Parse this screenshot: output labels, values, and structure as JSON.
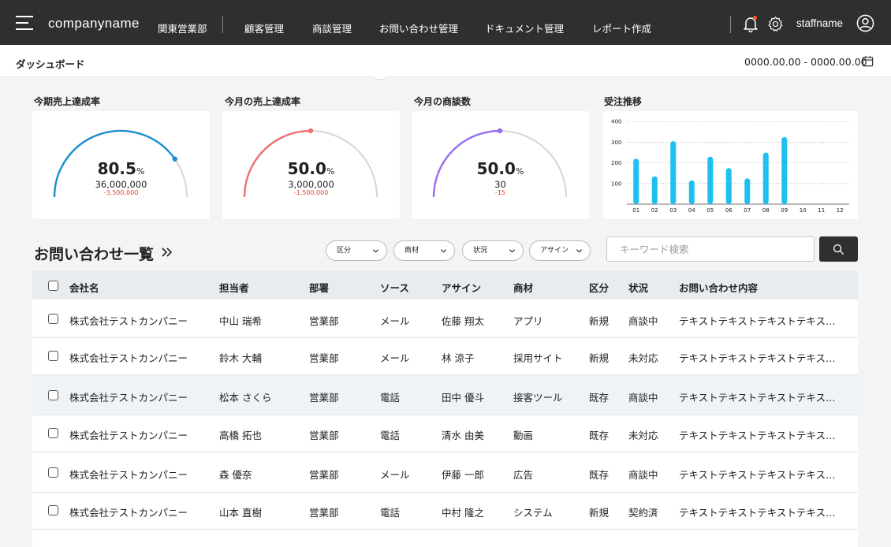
{
  "header": {
    "brand": "companyname",
    "department": "関東営業部",
    "nav": [
      "顧客管理",
      "商談管理",
      "お問い合わせ管理",
      "ドキュメント管理",
      "レポート作成"
    ],
    "user": "staffname"
  },
  "subbar": {
    "title": "ダッシュボード",
    "date_range": "0000.00.00 - 0000.00.00"
  },
  "kpis": [
    {
      "label": "今期売上達成率",
      "value": "80.5",
      "unit": "%",
      "amount": "36,000,000",
      "diff": "-3,500,000",
      "fraction": 0.805,
      "color": "#1b8fd0"
    },
    {
      "label": "今月の売上達成率",
      "value": "50.0",
      "unit": "%",
      "amount": "3,000,000",
      "diff": "-1,500,000",
      "fraction": 0.5,
      "color": "#f07070"
    },
    {
      "label": "今月の商談数",
      "value": "50.0",
      "unit": "%",
      "amount": "30",
      "diff": "-15",
      "fraction": 0.5,
      "color": "#9b6ef0"
    }
  ],
  "orders_chart_label": "受注推移",
  "chart_data": {
    "type": "bar",
    "categories": [
      "01",
      "02",
      "03",
      "04",
      "05",
      "06",
      "07",
      "08",
      "09",
      "10",
      "11",
      "12"
    ],
    "values": [
      220,
      135,
      305,
      115,
      230,
      175,
      125,
      250,
      325,
      null,
      null,
      null
    ],
    "yticks": [
      100,
      200,
      300,
      400
    ],
    "ylim": [
      0,
      420
    ],
    "grid": true,
    "color": "#1ec0f0"
  },
  "inquiries": {
    "title": "お問い合わせ一覧",
    "filters": [
      "区分",
      "商材",
      "状況",
      "アサイン"
    ],
    "search_placeholder": "キーワード検索",
    "columns": [
      "会社名",
      "担当者",
      "部署",
      "ソース",
      "アサイン",
      "商材",
      "区分",
      "状況",
      "お問い合わせ内容"
    ],
    "rows": [
      {
        "company": "株式会社テストカンパニー",
        "person": "中山 瑞希",
        "dept": "営業部",
        "source": "メール",
        "assignee": "佐藤 翔太",
        "product": "アプリ",
        "category": "新規",
        "status": "商談中",
        "content": "テキストテキストテキストテキスト…"
      },
      {
        "company": "株式会社テストカンパニー",
        "person": "鈴木 大輔",
        "dept": "営業部",
        "source": "メール",
        "assignee": "林 涼子",
        "product": "採用サイト",
        "category": "新規",
        "status": "未対応",
        "content": "テキストテキストテキストテキスト…"
      },
      {
        "company": "株式会社テストカンパニー",
        "person": "松本 さくら",
        "dept": "営業部",
        "source": "電話",
        "assignee": "田中 優斗",
        "product": "接客ツール",
        "category": "既存",
        "status": "商談中",
        "content": "テキストテキストテキストテキスト…"
      },
      {
        "company": "株式会社テストカンパニー",
        "person": "高橋 拓也",
        "dept": "営業部",
        "source": "電話",
        "assignee": "清水 由美",
        "product": "動画",
        "category": "既存",
        "status": "未対応",
        "content": "テキストテキストテキストテキスト…"
      },
      {
        "company": "株式会社テストカンパニー",
        "person": "森 優奈",
        "dept": "営業部",
        "source": "メール",
        "assignee": "伊藤 一郎",
        "product": "広告",
        "category": "既存",
        "status": "商談中",
        "content": "テキストテキストテキストテキスト…"
      },
      {
        "company": "株式会社テストカンパニー",
        "person": "山本 直樹",
        "dept": "営業部",
        "source": "電話",
        "assignee": "中村 隆之",
        "product": "システム",
        "category": "新規",
        "status": "契約済",
        "content": "テキストテキストテキストテキスト…"
      }
    ]
  }
}
